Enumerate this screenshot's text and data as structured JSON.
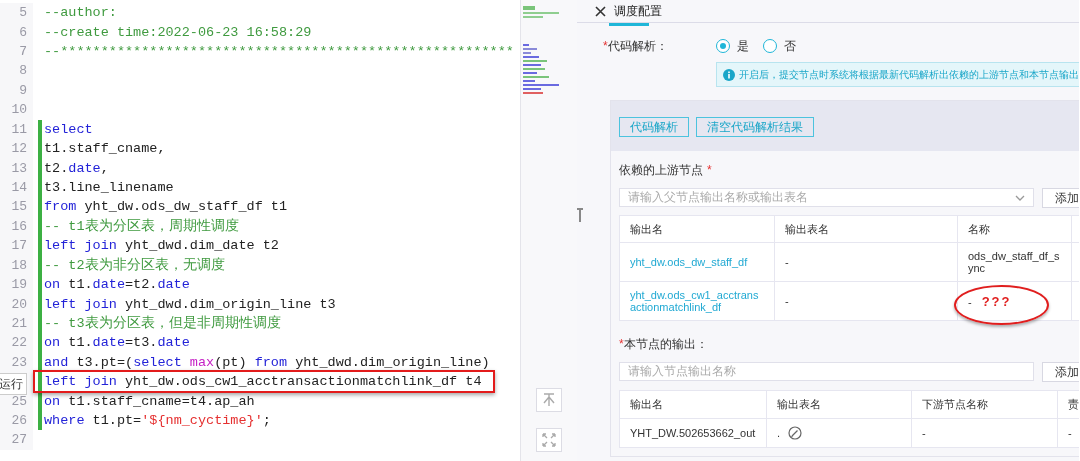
{
  "editor": {
    "side_label": "运行",
    "lines": [
      {
        "number": "5",
        "modified": false,
        "highlighted": false,
        "tokens": [
          {
            "kind": "comment",
            "text": "--author:"
          }
        ]
      },
      {
        "number": "6",
        "modified": false,
        "highlighted": false,
        "tokens": [
          {
            "kind": "comment",
            "text": "--create time:2022-06-23 16:58:29"
          }
        ]
      },
      {
        "number": "7",
        "modified": false,
        "highlighted": false,
        "tokens": [
          {
            "kind": "comment",
            "text": "--********************************************************"
          }
        ]
      },
      {
        "number": "8",
        "modified": false,
        "highlighted": false
      },
      {
        "number": "9",
        "modified": false,
        "highlighted": false
      },
      {
        "number": "10",
        "modified": false,
        "highlighted": false
      },
      {
        "number": "11",
        "modified": true,
        "highlighted": false,
        "tokens": [
          {
            "kind": "keyword",
            "text": "select"
          }
        ]
      },
      {
        "number": "12",
        "modified": true,
        "highlighted": false,
        "tokens": [
          {
            "kind": "plain",
            "text": "t1.staff_cname,"
          }
        ]
      },
      {
        "number": "13",
        "modified": true,
        "highlighted": false,
        "tokens": [
          {
            "kind": "plain",
            "text": "t2."
          },
          {
            "kind": "keyword",
            "text": "date"
          },
          {
            "kind": "plain",
            "text": ","
          }
        ]
      },
      {
        "number": "14",
        "modified": true,
        "highlighted": false,
        "tokens": [
          {
            "kind": "plain",
            "text": "t3.line_linename"
          }
        ]
      },
      {
        "number": "15",
        "modified": true,
        "highlighted": false,
        "tokens": [
          {
            "kind": "keyword",
            "text": "from"
          },
          {
            "kind": "plain",
            "text": " yht_dw.ods_dw_staff_df t1"
          }
        ]
      },
      {
        "number": "16",
        "modified": true,
        "highlighted": false,
        "tokens": [
          {
            "kind": "comment",
            "text": "-- t1表为分区表，周期性调度"
          }
        ]
      },
      {
        "number": "17",
        "modified": true,
        "highlighted": false,
        "tokens": [
          {
            "kind": "keyword",
            "text": "left join"
          },
          {
            "kind": "plain",
            "text": " yht_dwd.dim_date t2"
          }
        ]
      },
      {
        "number": "18",
        "modified": true,
        "highlighted": false,
        "tokens": [
          {
            "kind": "comment",
            "text": "-- t2表为非分区表，无调度"
          }
        ]
      },
      {
        "number": "19",
        "modified": true,
        "highlighted": false,
        "tokens": [
          {
            "kind": "keyword",
            "text": "on"
          },
          {
            "kind": "plain",
            "text": " t1."
          },
          {
            "kind": "keyword",
            "text": "date"
          },
          {
            "kind": "plain",
            "text": "=t2."
          },
          {
            "kind": "keyword",
            "text": "date"
          }
        ]
      },
      {
        "number": "20",
        "modified": true,
        "highlighted": false,
        "tokens": [
          {
            "kind": "keyword",
            "text": "left join"
          },
          {
            "kind": "plain",
            "text": " yht_dwd.dim_origin_line t3"
          }
        ]
      },
      {
        "number": "21",
        "modified": true,
        "highlighted": false,
        "tokens": [
          {
            "kind": "comment",
            "text": "-- t3表为分区表，但是非周期性调度"
          }
        ]
      },
      {
        "number": "22",
        "modified": true,
        "highlighted": false,
        "tokens": [
          {
            "kind": "keyword",
            "text": "on"
          },
          {
            "kind": "plain",
            "text": " t1."
          },
          {
            "kind": "keyword",
            "text": "date"
          },
          {
            "kind": "plain",
            "text": "=t3."
          },
          {
            "kind": "keyword",
            "text": "date"
          }
        ]
      },
      {
        "number": "23",
        "modified": true,
        "highlighted": false,
        "tokens": [
          {
            "kind": "keyword",
            "text": "and"
          },
          {
            "kind": "plain",
            "text": " t3.pt=("
          },
          {
            "kind": "keyword",
            "text": "select"
          },
          {
            "kind": "function",
            "text": " max"
          },
          {
            "kind": "plain",
            "text": "(pt) "
          },
          {
            "kind": "keyword",
            "text": "from"
          },
          {
            "kind": "plain",
            "text": " yht_dwd.dim_origin_line)"
          }
        ]
      },
      {
        "modified": true,
        "highlighted": true,
        "tokens": [
          {
            "kind": "keyword",
            "text": "left join"
          },
          {
            "kind": "plain",
            "text": " yht_dw.ods_cw1_acctransactionmatchlink_df t4"
          }
        ]
      },
      {
        "number": "25",
        "modified": true,
        "highlighted": false,
        "tokens": [
          {
            "kind": "keyword",
            "text": "on"
          },
          {
            "kind": "plain",
            "text": " t1.staff_cname=t4.ap_ah"
          }
        ]
      },
      {
        "number": "26",
        "modified": true,
        "highlighted": false,
        "tokens": [
          {
            "kind": "keyword",
            "text": "where"
          },
          {
            "kind": "plain",
            "text": " t1.pt="
          },
          {
            "kind": "string",
            "text": "'${nm_cyctime}'"
          },
          {
            "kind": "plain",
            "text": ";"
          }
        ]
      },
      {
        "number": "27",
        "modified": false,
        "highlighted": false
      }
    ]
  },
  "panel": {
    "title": "调度配置",
    "code_parse": {
      "label": "代码解析：",
      "required_mark": "*",
      "options": [
        {
          "label": "是",
          "selected": true
        },
        {
          "label": "否",
          "selected": false
        }
      ]
    },
    "info": "开启后，提交节点时系统将根据最新代码解析出依赖的上游节点和本节点输出",
    "buttons": [
      "代码解析",
      "清空代码解析结果"
    ],
    "upstream": {
      "label": "依赖的上游节点",
      "required_mark": "*",
      "placeholder": "请输入父节点输出名称或输出表名",
      "add_button": "添加",
      "columns": [
        "输出名",
        "输出表名",
        "名称"
      ],
      "rows": [
        {
          "cells": [
            {
              "kind": "link",
              "text": "yht_dw.ods_dw_staff_df"
            },
            {
              "kind": "text",
              "text": "-"
            },
            {
              "kind": "text",
              "text": "ods_dw_staff_df_sync"
            }
          ]
        },
        {
          "cells": [
            {
              "kind": "link",
              "text": "yht_dw.ods_cw1_acctransactionmatchlink_df"
            },
            {
              "kind": "text",
              "text": "-"
            },
            {
              "kind": "text",
              "text": "-"
            }
          ],
          "annotation": "???"
        }
      ]
    },
    "outputs": {
      "label": "本节点的输出：",
      "required_mark": "*",
      "placeholder": "请输入节点输出名称",
      "add_button": "添加",
      "columns": [
        "输出名",
        "输出表名",
        "下游节点名称",
        "责"
      ],
      "rows": [
        {
          "cells": [
            {
              "kind": "text",
              "text": "YHT_DW.502653662_out"
            },
            {
              "kind": "editable",
              "text": "."
            },
            {
              "kind": "text",
              "text": "-"
            },
            {
              "kind": "text",
              "text": "-"
            }
          ]
        }
      ]
    }
  }
}
